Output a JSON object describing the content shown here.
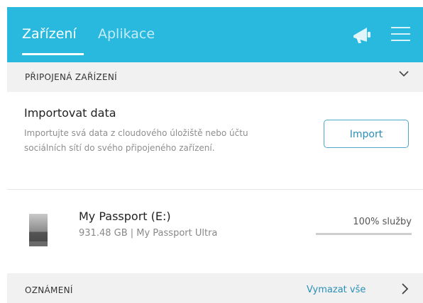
{
  "header": {
    "tabs": [
      {
        "label": "Zařízení",
        "active": true
      },
      {
        "label": "Aplikace",
        "active": false
      }
    ],
    "icons": [
      "megaphone-icon",
      "hamburger-menu-icon"
    ],
    "background_color": "#29b9de"
  },
  "connected_section": {
    "title": "PŘIPOJENÁ ZAŘÍZENÍ",
    "toggle_icon": "chevron-down-icon"
  },
  "import_data": {
    "title": "Importovat data",
    "description": "Importujte svá data z cloudového úložiště nebo účtu sociálních sítí do svého připojeného zařízení.",
    "button_label": "Import"
  },
  "drive": {
    "name": "My Passport (E:)",
    "details": "931.48 GB | My Passport Ultra",
    "health_label": "100% služby",
    "health_percent": 100,
    "icon": "drive-icon"
  },
  "notifications": {
    "title": "OZNÁMENÍ",
    "clear_label": "Vymazat vše",
    "expand_icon": "chevron-right-icon"
  },
  "colors": {
    "accent": "#29b9de",
    "link": "#2a8fb7",
    "section_bg": "#f1f1f1"
  }
}
